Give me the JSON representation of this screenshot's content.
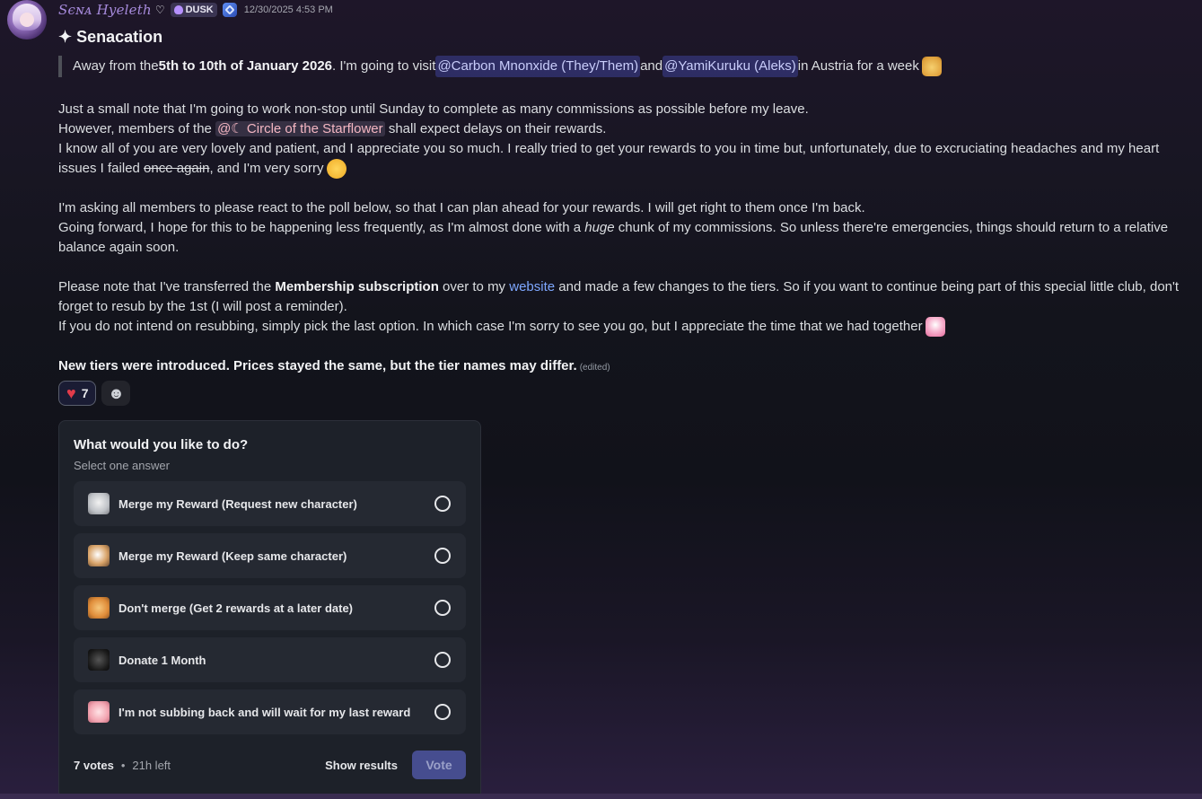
{
  "author": {
    "name": "Sєɴᴀ Hyeleth",
    "tag": "DUSK",
    "timestamp": "12/30/2025 4:53 PM"
  },
  "title": "✦ Senacation",
  "quote": {
    "pre": "Away from the ",
    "dates": "5th to 10th of January 2026",
    "mid": ". I'm going to visit ",
    "mention1": "@Carbon Mnonxide (They/Them)",
    "and": " and ",
    "mention2": "@YamiKuruku (Aleks)",
    "post": " in Austria for a week"
  },
  "p1": {
    "line1": "Just a small note that I'm going to work non-stop until Sunday to complete as many commissions as possible before my leave.",
    "line2_pre": "However, members of the ",
    "role": "@☾ Circle of the Starflower",
    "line2_post": " shall expect delays on their rewards.",
    "line3": "I know all of you are very lovely and patient, and I appreciate you so much. I really tried to get your rewards to you in time but, unfortunately, due to excruciating headaches and my heart issues I failed ",
    "strike": "once again",
    "line3_post": ", and I'm very sorry"
  },
  "p2": {
    "line1": "I'm asking  all members to please react to the poll below, so that I can plan ahead for your rewards. I will get right to them once I'm back.",
    "line2_pre": "Going forward, I hope for this to be happening less frequently, as I'm almost done with a ",
    "italic": "huge",
    "line2_post": " chunk of my commissions. So unless there're emergencies, things should return to a relative balance again soon."
  },
  "p3": {
    "line1_pre": "Please note that I've transferred the ",
    "bold": "Membership subscription",
    "line1_mid": " over to my ",
    "link": "website",
    "line1_post": " and made a few changes to the tiers. So if you want to continue being part of this special little club, don't forget to resub by the 1st (I will post a reminder).",
    "line2": "If you do not intend on resubbing, simply pick the last option. In which case I'm sorry to see you go, but I appreciate the time that we had together"
  },
  "p4": {
    "bold": "New tiers were introduced. Prices stayed the same, but the tier names may differ.",
    "edited": "(edited)"
  },
  "reactions": {
    "heart_count": "7"
  },
  "poll": {
    "question": "What would you like to do?",
    "subtitle": "Select one answer",
    "answers": [
      {
        "label": "Merge my Reward (Request new character)",
        "icon": "cat-emoji"
      },
      {
        "label": "Merge my Reward (Keep same character)",
        "icon": "cat-emoji"
      },
      {
        "label": "Don't merge (Get 2 rewards at a later date)",
        "icon": "cat-emoji"
      },
      {
        "label": "Donate 1 Month",
        "icon": "cat-emoji"
      },
      {
        "label": "I'm not subbing back and will wait for my last reward",
        "icon": "cat-emoji"
      }
    ],
    "votes": "7 votes",
    "dot": "•",
    "time_left": "21h left",
    "show_results": "Show results",
    "vote": "Vote"
  },
  "colors": {
    "username": "#a78bdc",
    "mention_bg": "#3a3f7a",
    "link": "#7ea7ff",
    "vote_button": "#464d8f",
    "heart": "#e23b4a"
  }
}
